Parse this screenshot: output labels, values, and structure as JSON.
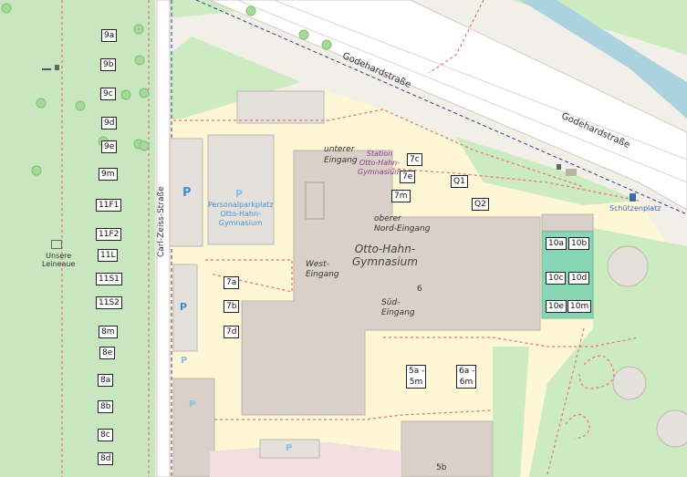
{
  "streets": {
    "main_road": "Godehardstraße",
    "side_road": "Carl-Zeiss-Straße"
  },
  "places": {
    "school_name": "Otto-Hahn-\nGymnasium",
    "park_name": "Unsere\nLeineaue",
    "parking_name": "Personalparkplatz\nOtto-Hahn-\nGymnasium",
    "station_name": "Station\nOtto-Hahn-\nGymnasium",
    "bus_stop": "Schützenplatz",
    "number_6": "6",
    "building_5b": "5b"
  },
  "entrances": {
    "lower": "unterer\nEingang",
    "upper_north": "oberer\nNord-Eingang",
    "west": "West-\nEingang",
    "south": "Süd-\nEingang"
  },
  "parking_symbol": "P",
  "room_labels": {
    "r9a": "9a",
    "r9b": "9b",
    "r9c": "9c",
    "r9d": "9d",
    "r9e": "9e",
    "r9m": "9m",
    "r11F1": "11F1",
    "r11F2": "11F2",
    "r11L": "11L",
    "r11S1": "11S1",
    "r11S2": "11S2",
    "r8m": "8m",
    "r8e": "8e",
    "r8a": "8a",
    "r8b": "8b",
    "r8c": "8c",
    "r8d": "8d",
    "r7a": "7a",
    "r7b": "7b",
    "r7d": "7d",
    "r7c": "7c",
    "r7e": "7e",
    "r7m": "7m",
    "rQ1": "Q1",
    "rQ2": "Q2",
    "r10a": "10a",
    "r10b": "10b",
    "r10c": "10c",
    "r10d": "10d",
    "r10e": "10e",
    "r10m": "10m",
    "r5a5m": "5a -\n5m",
    "r6a6m": "6a -\n6m"
  },
  "colors": {
    "park": "#c8e6bf",
    "campus": "#fdf7d6",
    "building": "#d9d0c9",
    "road": "#ffffff",
    "path": "#f06b6b",
    "water": "#aad3df",
    "sports": "#88d6b6"
  }
}
